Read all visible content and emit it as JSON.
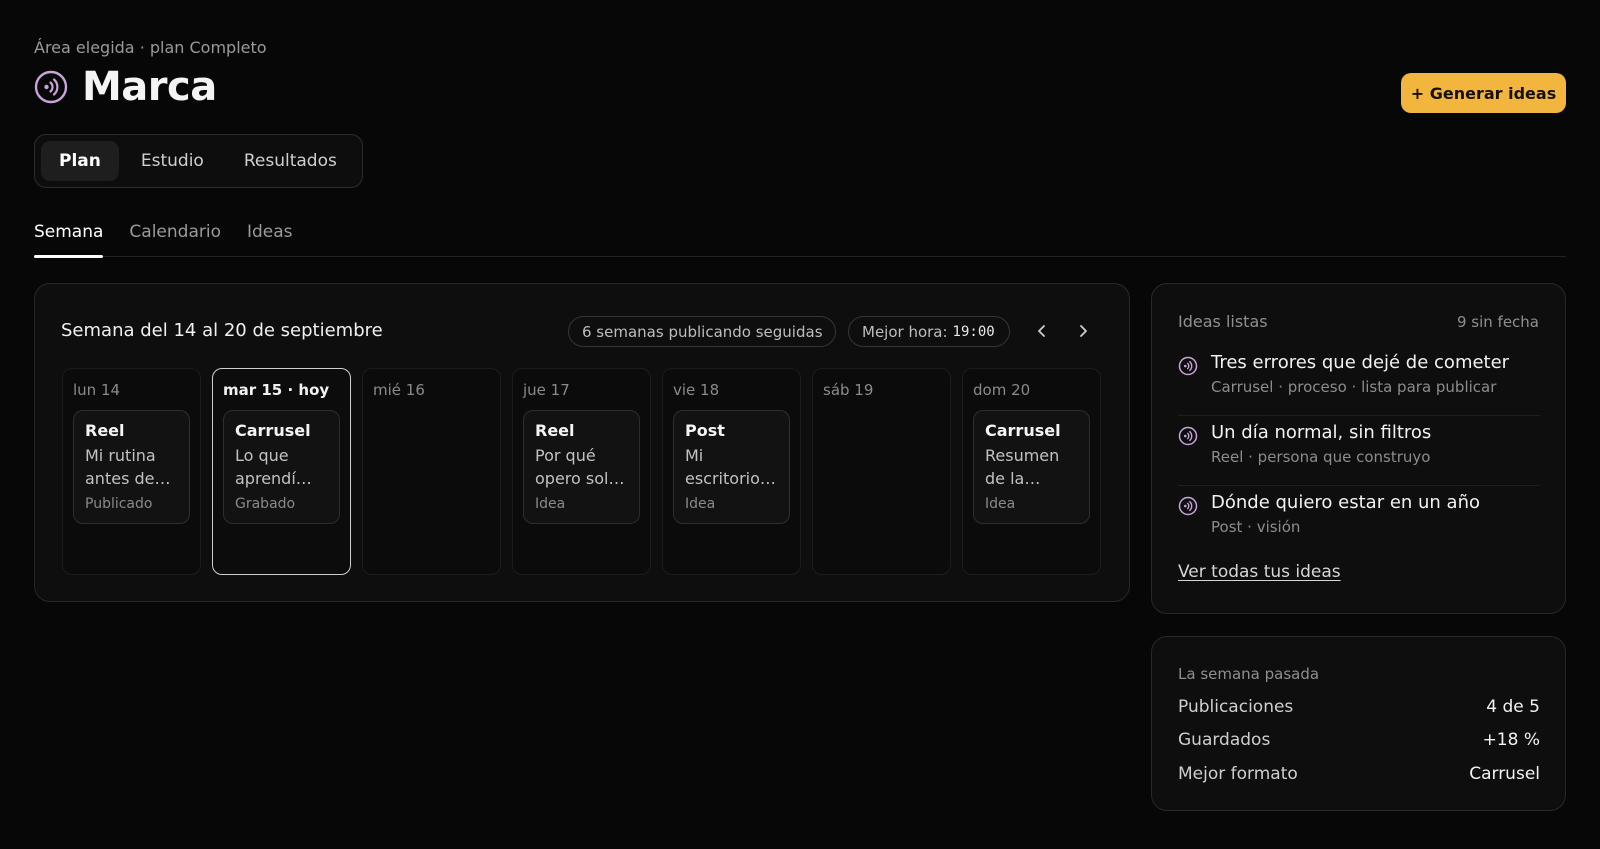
{
  "header": {
    "breadcrumb": "Área elegida · plan Completo",
    "title": "Marca",
    "brand_icon": "broadcast-icon",
    "generate_button": "+ Generar ideas",
    "accent_color": "#f2b53d"
  },
  "segments": [
    {
      "label": "Plan",
      "active": true
    },
    {
      "label": "Estudio",
      "active": false
    },
    {
      "label": "Resultados",
      "active": false
    }
  ],
  "subtabs": [
    {
      "label": "Semana",
      "active": true
    },
    {
      "label": "Calendario",
      "active": false
    },
    {
      "label": "Ideas",
      "active": false
    }
  ],
  "week": {
    "title": "Semana del 14 al 20 de septiembre",
    "streak": "6 semanas publicando seguidas",
    "best_hour_label": "Mejor hora:",
    "best_hour_value": "19:00",
    "days": [
      {
        "label": "lun 14",
        "today": false,
        "card": {
          "type": "Reel",
          "text": "Mi rutina antes de…",
          "status": "Publicado"
        }
      },
      {
        "label": "mar 15 · hoy",
        "today": true,
        "card": {
          "type": "Carrusel",
          "text": "Lo que aprendí…",
          "status": "Grabado"
        }
      },
      {
        "label": "mié 16",
        "today": false,
        "card": null
      },
      {
        "label": "jue 17",
        "today": false,
        "card": {
          "type": "Reel",
          "text": "Por qué opero sol…",
          "status": "Idea"
        }
      },
      {
        "label": "vie 18",
        "today": false,
        "card": {
          "type": "Post",
          "text": "Mi escritorio…",
          "status": "Idea"
        }
      },
      {
        "label": "sáb 19",
        "today": false,
        "card": null
      },
      {
        "label": "dom 20",
        "today": false,
        "card": {
          "type": "Carrusel",
          "text": "Resumen de la…",
          "status": "Idea"
        }
      }
    ]
  },
  "ideas": {
    "heading": "Ideas listas",
    "count": "9 sin fecha",
    "items": [
      {
        "title": "Tres errores que dejé de cometer",
        "meta": "Carrusel · proceso · lista para publicar",
        "icon": "broadcast-icon"
      },
      {
        "title": "Un día normal, sin filtros",
        "meta": "Reel · persona que construyo",
        "icon": "broadcast-icon"
      },
      {
        "title": "Dónde quiero estar en un año",
        "meta": "Post · visión",
        "icon": "broadcast-icon"
      }
    ],
    "link": "Ver todas tus ideas"
  },
  "stats": {
    "heading": "La semana pasada",
    "rows": [
      {
        "label": "Publicaciones",
        "value": "4 de 5"
      },
      {
        "label": "Guardados",
        "value": "+18 %"
      },
      {
        "label": "Mejor formato",
        "value": "Carrusel"
      }
    ]
  }
}
